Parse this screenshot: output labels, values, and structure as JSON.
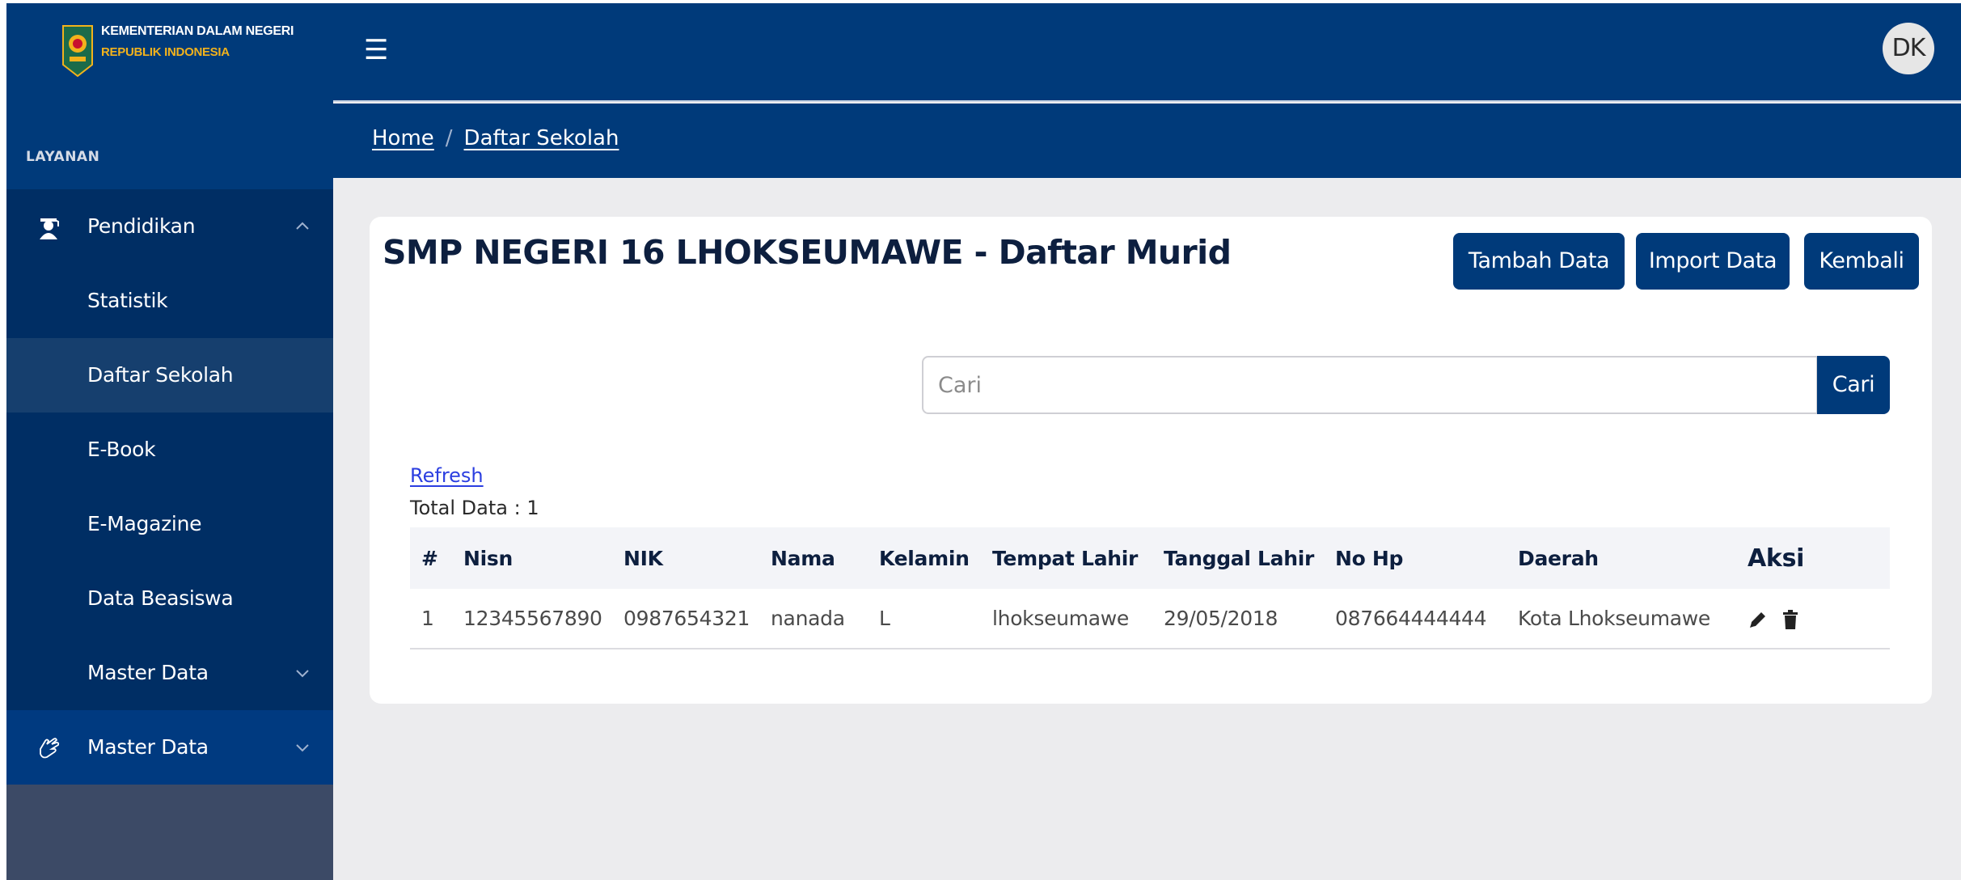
{
  "brand": {
    "line1": "KEMENTERIAN DALAM NEGERI",
    "line2": "REPUBLIK INDONESIA"
  },
  "sidebar": {
    "section_label": "LAYANAN",
    "items": [
      {
        "label": "Pendidikan",
        "icon": "graduate-icon",
        "chevron": "chevron-up-icon"
      },
      {
        "label": "Statistik"
      },
      {
        "label": "Daftar Sekolah"
      },
      {
        "label": "E-Book"
      },
      {
        "label": "E-Magazine"
      },
      {
        "label": "Data Beasiswa"
      },
      {
        "label": "Master Data",
        "chevron": "chevron-down-icon"
      },
      {
        "label": "Master Data",
        "icon": "hand-icon",
        "chevron": "chevron-down-icon"
      }
    ]
  },
  "header": {
    "menu_icon": "hamburger-icon",
    "avatar_initials": "DK"
  },
  "breadcrumb": {
    "home": "Home",
    "separator": "/",
    "current": "Daftar Sekolah"
  },
  "main": {
    "title": "SMP NEGERI 16 LHOKSEUMAWE - Daftar Murid",
    "buttons": {
      "tambah": "Tambah Data",
      "import": "Import Data",
      "kembali": "Kembali"
    },
    "search": {
      "placeholder": "Cari",
      "value": "",
      "button": "Cari"
    },
    "refresh_label": "Refresh",
    "total_label": "Total Data : 1",
    "table": {
      "headers": [
        "#",
        "Nisn",
        "NIK",
        "Nama",
        "Kelamin",
        "Tempat Lahir",
        "Tanggal Lahir",
        "No Hp",
        "Daerah",
        "Aksi"
      ],
      "rows": [
        [
          "1",
          "12345567890",
          "0987654321",
          "nanada",
          "L",
          "lhokseumawe",
          "29/05/2018",
          "087664444444",
          "Kota Lhokseumawe"
        ]
      ]
    }
  },
  "colors": {
    "primary": "#003a7a",
    "sidebar_item": "#002e64",
    "sidebar_active": "#163f6e",
    "background": "#ececee",
    "link": "#2b3ee0"
  }
}
